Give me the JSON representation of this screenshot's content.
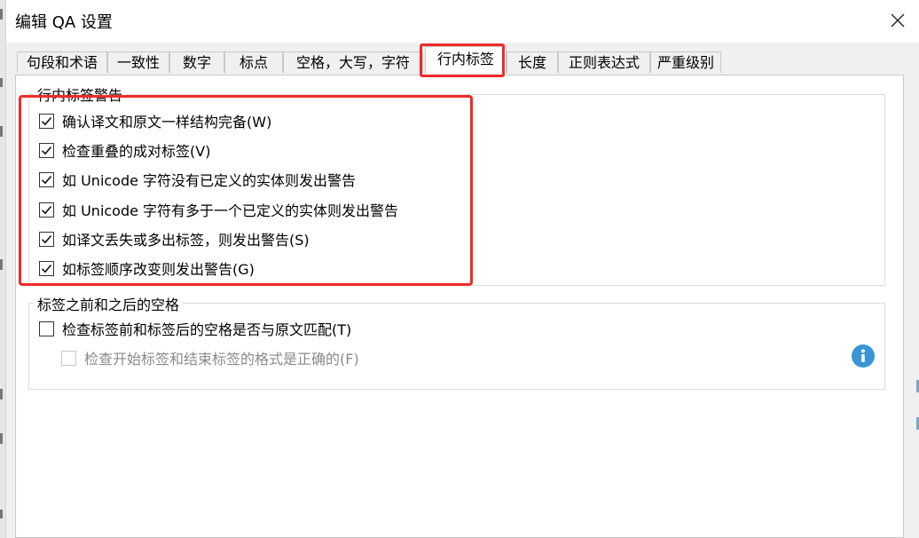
{
  "window": {
    "title": "编辑 QA 设置"
  },
  "tabs": [
    {
      "label": "句段和术语"
    },
    {
      "label": "一致性"
    },
    {
      "label": "数字"
    },
    {
      "label": "标点"
    },
    {
      "label": "空格，大写，字符"
    },
    {
      "label": "行内标签",
      "active": true
    },
    {
      "label": "长度"
    },
    {
      "label": "正则表达式"
    },
    {
      "label": "严重级别"
    }
  ],
  "group1": {
    "legend": "行内标签警告",
    "items": [
      {
        "label": "确认译文和原文一样结构完备(W)",
        "checked": true
      },
      {
        "label": "检查重叠的成对标签(V)",
        "checked": true
      },
      {
        "label": "如 Unicode 字符没有已定义的实体则发出警告",
        "checked": true
      },
      {
        "label": "如 Unicode 字符有多于一个已定义的实体则发出警告",
        "checked": true
      },
      {
        "label": "如译文丢失或多出标签，则发出警告(S)",
        "checked": true
      },
      {
        "label": "如标签顺序改变则发出警告(G)",
        "checked": true
      }
    ]
  },
  "group2": {
    "legend": "标签之前和之后的空格",
    "items": [
      {
        "label": "检查标签前和标签后的空格是否与原文匹配(T)",
        "checked": false,
        "enabled": true
      },
      {
        "label": "检查开始标签和结束标签的格式是正确的(F)",
        "checked": false,
        "enabled": false
      }
    ]
  },
  "icons": {
    "info": "info-icon",
    "close": "close-icon",
    "check": "checkmark-icon"
  },
  "colors": {
    "highlight": "#f02a2a",
    "info": "#3a95d6"
  }
}
